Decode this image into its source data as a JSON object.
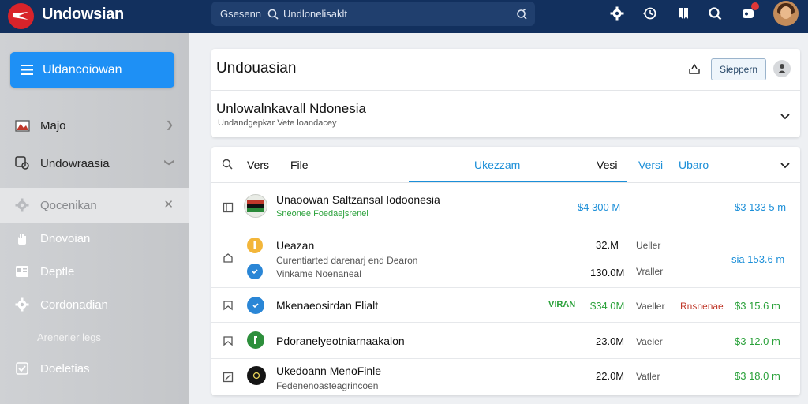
{
  "app": {
    "title": "Undowsian"
  },
  "search": {
    "label": "Gsesenn",
    "value": "Undlonelisaklt"
  },
  "sidebar": {
    "primary_button": "Uldancoiowan",
    "items": [
      {
        "label": "Majo"
      },
      {
        "label": "Undowraasia"
      },
      {
        "label": "Qocenikan"
      },
      {
        "label": "Dnovoian"
      },
      {
        "label": "Deptle"
      },
      {
        "label": "Cordonadian"
      }
    ],
    "section_label": "Arenerier legs",
    "last_item": "Doeletias"
  },
  "header": {
    "title": "Undouasian",
    "signup_button": "Sieppern",
    "subtitle": "Unlowalnkavall Ndonesia",
    "subtitle_small": "Undandgepkar Vete loandacey"
  },
  "tabs": {
    "items": [
      {
        "label": "Vers",
        "color": "#111111"
      },
      {
        "label": "File",
        "color": "#111111"
      },
      {
        "label": "Ukezzam",
        "color": "#1c8fd8"
      },
      {
        "label": "Vesi",
        "color": "#111111"
      },
      {
        "label": "Versi",
        "color": "#1c8fd8"
      },
      {
        "label": "Ubaro",
        "color": "#1c8fd8"
      }
    ]
  },
  "rows": [
    {
      "name": "Unaoowan Saltzansal Iodoonesia",
      "sub": "Sneonee Foedaejsrenel",
      "price": "$4 300 M",
      "total": "$3 133 5 m"
    },
    {
      "name": "Ueazan",
      "sub1": "Curentiarted darenarj end Dearon",
      "sub2": "Vinkame Noenaneal",
      "size1": "32.M",
      "size2": "130.0M",
      "label1": "Ueller",
      "label2": "Vraller",
      "total": "sia 153.6 m"
    },
    {
      "name": "Mkenaeosirdan Flialt",
      "tag": "VIRAN",
      "price": "$34 0M",
      "label": "Vaeller",
      "extra": "Rnsnenae",
      "total": "$3 15.6 m"
    },
    {
      "name": "Pdoranelyeotniarnaakalon",
      "size": "23.0M",
      "label": "Vaeler",
      "total": "$3 12.0 m"
    },
    {
      "name": "Ukedoann MenoFinle",
      "sub": "Fedenenoasteagrincoen",
      "size": "22.0M",
      "label": "Vatler",
      "total": "$3 18.0 m"
    }
  ],
  "colors": {
    "topbar": "#12305e",
    "accent": "#1e90f5",
    "link": "#1c8fd8",
    "positive": "#2aa13a",
    "logo": "#d8232a"
  }
}
